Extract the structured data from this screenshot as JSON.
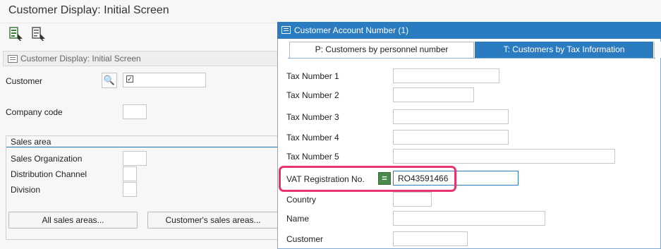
{
  "window": {
    "title": "Customer Display: Initial Screen"
  },
  "toolbar": {
    "icons": [
      "other-object-icon",
      "display-object-icon"
    ]
  },
  "main": {
    "section_title": "Customer Display: Initial Screen",
    "customer": {
      "label": "Customer",
      "value": ""
    },
    "company_code": {
      "label": "Company code",
      "value": ""
    },
    "sales_area": {
      "title": "Sales area",
      "sales_org_label": "Sales Organization",
      "dist_channel_label": "Distribution Channel",
      "division_label": "Division"
    },
    "buttons": {
      "all_sales_areas": "All sales areas...",
      "customers_sales_areas": "Customer's sales areas..."
    }
  },
  "dialog": {
    "title": "Customer Account Number (1)",
    "tabs": [
      {
        "label": "P: Customers by personnel number",
        "active": false
      },
      {
        "label": "T: Customers by Tax Information",
        "active": true
      }
    ],
    "fields": {
      "tax1": {
        "label": "Tax Number 1",
        "value": ""
      },
      "tax2": {
        "label": "Tax Number 2",
        "value": ""
      },
      "tax3": {
        "label": "Tax Number 3",
        "value": ""
      },
      "tax4": {
        "label": "Tax Number 4",
        "value": ""
      },
      "tax5": {
        "label": "Tax Number 5",
        "value": ""
      },
      "vat": {
        "label": "VAT Registration No.",
        "value": "RO43591466"
      },
      "country": {
        "label": "Country",
        "value": ""
      },
      "name": {
        "label": "Name",
        "value": ""
      },
      "customer": {
        "label": "Customer",
        "value": ""
      }
    },
    "match_symbol": "="
  },
  "colors": {
    "accent": "#2b7bc0",
    "highlight": "#e8336d",
    "match_button": "#4a8a4a"
  }
}
